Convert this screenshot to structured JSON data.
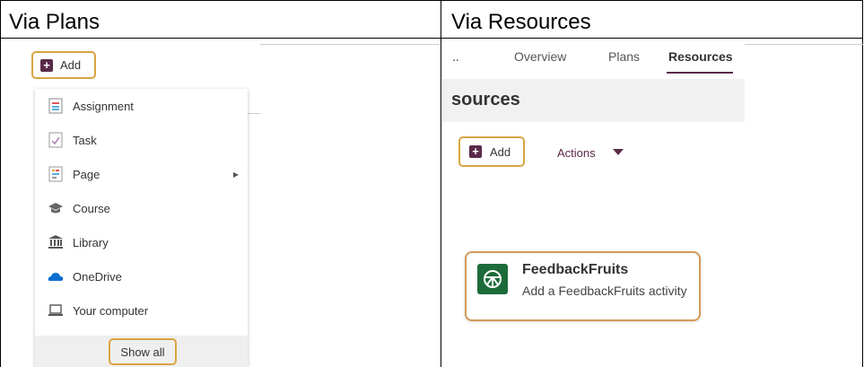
{
  "headers": {
    "left": "Via Plans",
    "right": "Via Resources"
  },
  "plans": {
    "add_label": "Add",
    "menu_items": [
      {
        "label": "Assignment",
        "icon": "assignment-icon"
      },
      {
        "label": "Task",
        "icon": "task-icon"
      },
      {
        "label": "Page",
        "icon": "page-icon"
      },
      {
        "label": "Course",
        "icon": "course-icon"
      },
      {
        "label": "Library",
        "icon": "library-icon"
      },
      {
        "label": "OneDrive",
        "icon": "onedrive-icon"
      },
      {
        "label": "Your computer",
        "icon": "computer-icon"
      }
    ],
    "show_all_label": "Show all"
  },
  "resources": {
    "tabs": {
      "ellipsis": "..",
      "overview": "Overview",
      "plans": "Plans",
      "resources": "Resources"
    },
    "banner_title": "sources",
    "add_label": "Add",
    "actions_label": "Actions",
    "feedbackfruits": {
      "title": "FeedbackFruits",
      "subtitle": "Add a FeedbackFruits activity"
    }
  },
  "colors": {
    "highlight": "#d9a441",
    "add_icon": "#5a2a4a",
    "ff_green": "#1e6b3a",
    "accent_tab": "#5a2a4a"
  }
}
